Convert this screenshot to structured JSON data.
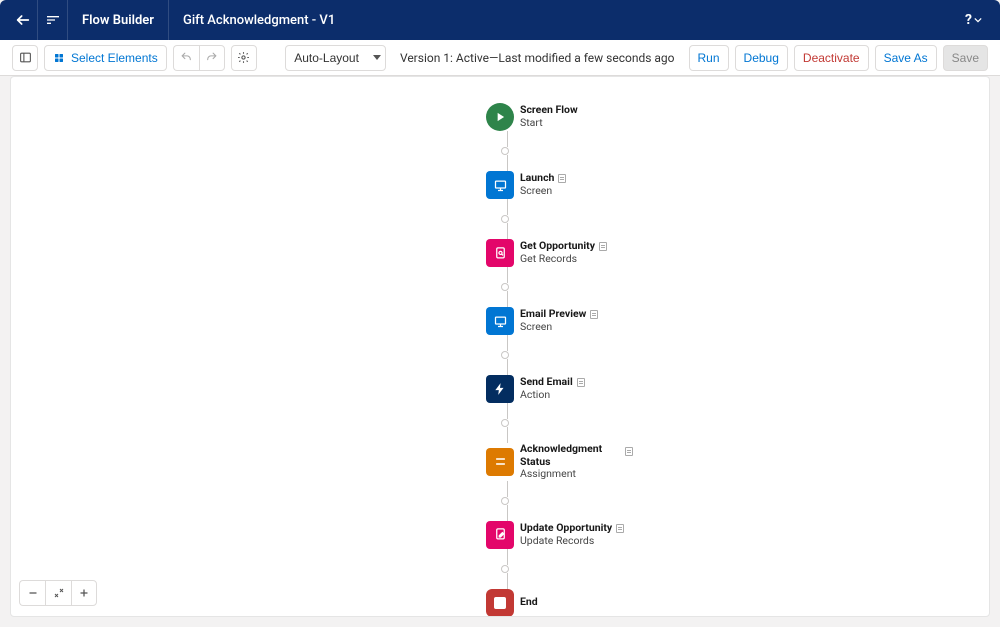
{
  "header": {
    "app_title": "Flow Builder",
    "flow_name": "Gift Acknowledgment - V1"
  },
  "toolbar": {
    "select_elements": "Select Elements",
    "layout_mode": "Auto-Layout",
    "version_text": "Version 1: Active—Last modified a few seconds ago",
    "run": "Run",
    "debug": "Debug",
    "deactivate": "Deactivate",
    "save_as": "Save As",
    "save": "Save"
  },
  "nodes": {
    "start": {
      "title": "Screen Flow",
      "sub": "Start"
    },
    "launch": {
      "title": "Launch",
      "sub": "Screen"
    },
    "get_opp": {
      "title": "Get Opportunity",
      "sub": "Get Records"
    },
    "email_preview": {
      "title": "Email Preview",
      "sub": "Screen"
    },
    "send_email": {
      "title": "Send Email",
      "sub": "Action"
    },
    "ack_status": {
      "title": "Acknowledgment Status",
      "sub": "Assignment"
    },
    "update_opp": {
      "title": "Update Opportunity",
      "sub": "Update Records"
    },
    "end": {
      "title": "End"
    }
  }
}
